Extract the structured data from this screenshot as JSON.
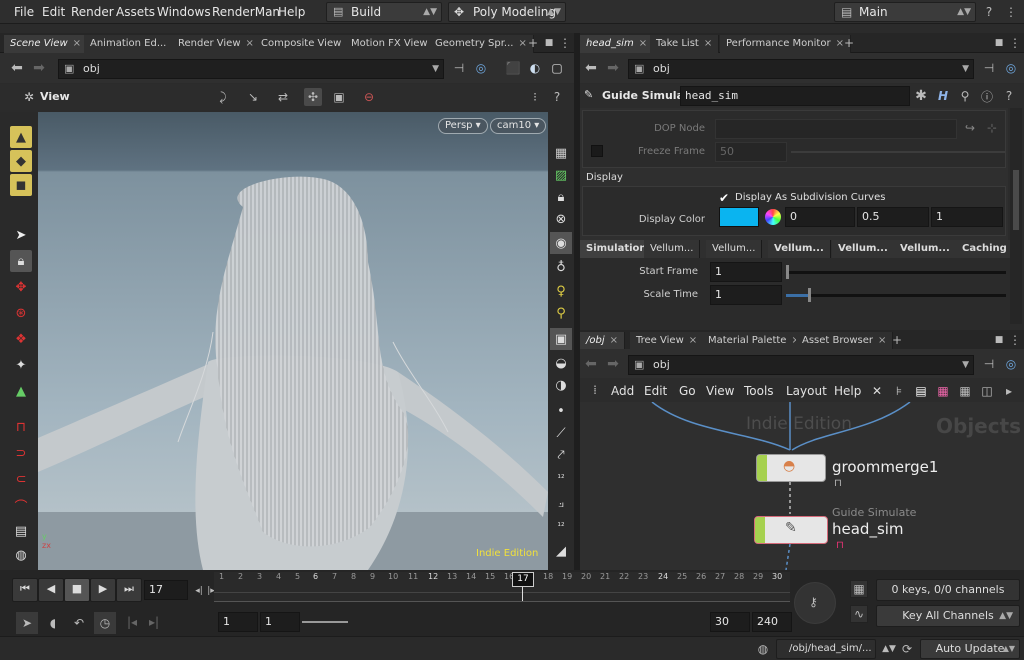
{
  "menubar": {
    "items": [
      "File",
      "Edit",
      "Render",
      "Assets",
      "Windows",
      "RenderMan",
      "Help"
    ],
    "desktop": "Build",
    "shelf_set": "Poly Modeling",
    "main": "Main"
  },
  "left_tabs": [
    "Scene View",
    "Animation Ed...",
    "Render View",
    "Composite View",
    "Motion FX View",
    "Geometry Spr..."
  ],
  "left_path": "obj",
  "viewer": {
    "label": "View",
    "persp": "Persp",
    "camera": "cam10",
    "edition": "Indie Edition"
  },
  "right_tabs": [
    "head_sim",
    "Take List",
    "Performance Monitor"
  ],
  "right_path": "obj",
  "params": {
    "node_type": "Guide Simulate",
    "node_name": "head_sim",
    "dop_node_label": "DOP Node",
    "freeze_frame_label": "Freeze Frame",
    "freeze_frame_value": "50",
    "display_section": "Display",
    "display_subdiv_label": "Display As Subdivision Curves",
    "display_color_label": "Display Color",
    "color_r": "0",
    "color_g": "0.5",
    "color_b": "1",
    "colors": {
      "display_color": "#0ab4f0"
    },
    "subtabs": [
      "Simulation",
      "Vellum...",
      "Vellum...",
      "Vellum...",
      "Vellum...",
      "Vellum...",
      "Caching"
    ],
    "start_frame_label": "Start Frame",
    "start_frame_value": "1",
    "start_frame_slider": 0.0,
    "scale_time_label": "Scale Time",
    "scale_time_value": "1",
    "scale_time_slider": 0.1
  },
  "network_tabs": [
    "/obj",
    "Tree View",
    "Material Palette",
    "Asset Browser"
  ],
  "network_path": "obj",
  "network_menu": [
    "Add",
    "Edit",
    "Go",
    "View",
    "Tools",
    "Layout",
    "Help"
  ],
  "network": {
    "watermark": "Indie Edition",
    "context": "Objects",
    "node1_name": "groommerge1",
    "node2_type": "Guide Simulate",
    "node2_name": "head_sim"
  },
  "timeline": {
    "current_frame": "17",
    "frame_marker": "17",
    "ticks": [
      "1",
      "2",
      "3",
      "4",
      "5",
      "6",
      "7",
      "8",
      "9",
      "10",
      "11",
      "12",
      "13",
      "14",
      "15",
      "16",
      "17",
      "18",
      "19",
      "20",
      "21",
      "22",
      "23",
      "24",
      "25",
      "26",
      "27",
      "28",
      "29",
      "30"
    ],
    "range_start": "1",
    "range_start2": "1",
    "range_end": "30",
    "range_end2": "240",
    "keys_info": "0 keys, 0/0 channels",
    "key_channels": "Key All Channels",
    "status_path": "/obj/head_sim/...",
    "update_mode": "Auto Update"
  }
}
